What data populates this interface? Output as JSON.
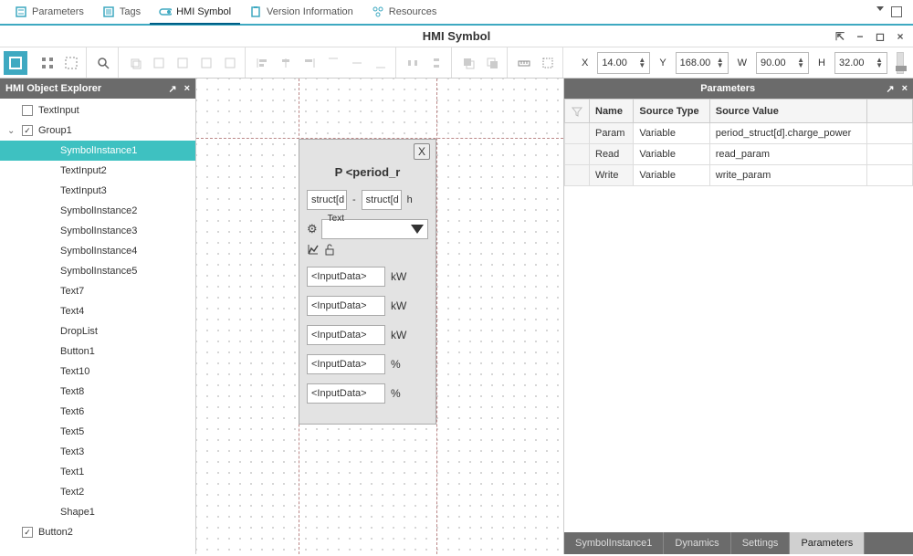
{
  "top_tabs": {
    "parameters": "Parameters",
    "tags": "Tags",
    "hmi_symbol": "HMI Symbol",
    "version_info": "Version Information",
    "resources": "Resources"
  },
  "title": "HMI Symbol",
  "coords": {
    "x_label": "X",
    "x": "14.00",
    "y_label": "Y",
    "y": "168.00",
    "w_label": "W",
    "w": "90.00",
    "h_label": "H",
    "h": "32.00"
  },
  "explorer": {
    "title": "HMI Object Explorer",
    "items": [
      {
        "label": "TextInput",
        "depth": 0,
        "checked": false
      },
      {
        "label": "Group1",
        "depth": 0,
        "checked": true,
        "expandable": true
      },
      {
        "label": "SymbolInstance1",
        "depth": 1,
        "selected": true
      },
      {
        "label": "TextInput2",
        "depth": 1
      },
      {
        "label": "TextInput3",
        "depth": 1
      },
      {
        "label": "SymbolInstance2",
        "depth": 1
      },
      {
        "label": "SymbolInstance3",
        "depth": 1
      },
      {
        "label": "SymbolInstance4",
        "depth": 1
      },
      {
        "label": "SymbolInstance5",
        "depth": 1
      },
      {
        "label": "Text7",
        "depth": 1
      },
      {
        "label": "Text4",
        "depth": 1
      },
      {
        "label": "DropList",
        "depth": 1
      },
      {
        "label": "Button1",
        "depth": 1
      },
      {
        "label": "Text10",
        "depth": 1
      },
      {
        "label": "Text8",
        "depth": 1
      },
      {
        "label": "Text6",
        "depth": 1
      },
      {
        "label": "Text5",
        "depth": 1
      },
      {
        "label": "Text3",
        "depth": 1
      },
      {
        "label": "Text1",
        "depth": 1
      },
      {
        "label": "Text2",
        "depth": 1
      },
      {
        "label": "Shape1",
        "depth": 1
      },
      {
        "label": "Button2",
        "depth": 0,
        "checked": true
      }
    ]
  },
  "symbol": {
    "close": "X",
    "title": "P <period_r",
    "time_from": "struct[d",
    "dash": "-",
    "time_to": "struct[d",
    "h": "h",
    "dd_label": "Text",
    "rows": [
      {
        "placeholder": "<InputData>",
        "unit": "kW"
      },
      {
        "placeholder": "<InputData>",
        "unit": "kW"
      },
      {
        "placeholder": "<InputData>",
        "unit": "kW"
      },
      {
        "placeholder": "<InputData>",
        "unit": "%"
      },
      {
        "placeholder": "<InputData>",
        "unit": "%"
      }
    ]
  },
  "params_panel": {
    "title": "Parameters",
    "headers": {
      "name": "Name",
      "source_type": "Source Type",
      "source_value": "Source Value"
    },
    "rows": [
      {
        "name": "Param",
        "type": "Variable",
        "value": "period_struct[d].charge_power"
      },
      {
        "name": "Read",
        "type": "Variable",
        "value": "read_param"
      },
      {
        "name": "Write",
        "type": "Variable",
        "value": "write_param"
      }
    ],
    "bottom_tabs": {
      "a": "SymbolInstance1",
      "b": "Dynamics",
      "c": "Settings",
      "d": "Parameters"
    }
  }
}
